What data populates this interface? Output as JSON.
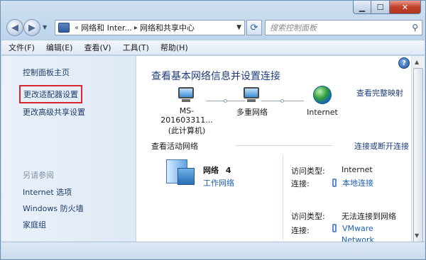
{
  "address": {
    "chevron": "«",
    "segment1": "网络和 Inter...",
    "arrow": "▸",
    "segment2": "网络和共享中心"
  },
  "search": {
    "placeholder": "搜索控制面板"
  },
  "menu": [
    "文件(F)",
    "编辑(E)",
    "查看(V)",
    "工具(T)",
    "帮助(H)"
  ],
  "sidebar": {
    "home": "控制面板主页",
    "adapter_settings": "更改适配器设置",
    "advanced_sharing": "更改高级共享设置",
    "see_also": "另请参阅",
    "internet_options": "Internet 选项",
    "firewall": "Windows 防火墙",
    "homegroup": "家庭组"
  },
  "main": {
    "title": "查看基本网络信息并设置连接",
    "full_map": "查看完整映射",
    "nodes": {
      "computer_line1": "MS-201603311...",
      "computer_line2": "(此计算机)",
      "network": "多重网络",
      "internet": "Internet"
    },
    "active_title": "查看活动网络",
    "connect_link": "连接或断开连接",
    "network": {
      "name": "网络",
      "number": "4",
      "type": "工作网络"
    },
    "conn1": {
      "access_label": "访问类型:",
      "access_value": "Internet",
      "conn_label": "连接:",
      "conn_value": "本地连接"
    },
    "conn2": {
      "access_label": "访问类型:",
      "access_value": "无法连接到网络",
      "conn_label": "连接:",
      "conn_value_1": "VMware",
      "conn_value_2": "Network"
    }
  },
  "icons": {
    "back": "back-arrow-icon",
    "forward": "forward-arrow-icon",
    "help": "help-icon",
    "search": "search-icon"
  },
  "colors": {
    "link": "#1e3d6b",
    "highlight_box": "#d9262d"
  }
}
